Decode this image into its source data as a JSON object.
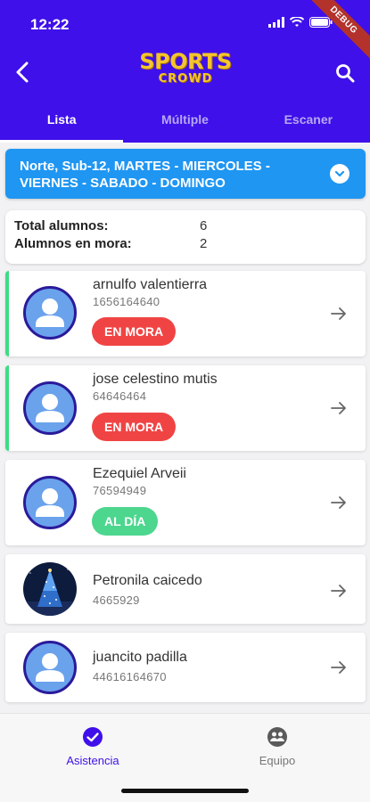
{
  "status": {
    "time": "12:22",
    "debug_label": "DEBUG"
  },
  "header": {
    "logo_line1": "SPORTS",
    "logo_line2": "CROWD"
  },
  "tabs": [
    {
      "label": "Lista",
      "active": true
    },
    {
      "label": "Múltiple",
      "active": false
    },
    {
      "label": "Escaner",
      "active": false
    }
  ],
  "schedule": {
    "text": "Norte, Sub-12, MARTES - MIERCOLES - VIERNES - SABADO - DOMINGO"
  },
  "totals": {
    "total_label": "Total alumnos:",
    "total_value": "6",
    "mora_label": "Alumnos en mora:",
    "mora_value": "2"
  },
  "students": [
    {
      "name": "arnulfo valentierra",
      "phone": "1656164640",
      "status": "EN MORA"
    },
    {
      "name": "jose celestino mutis",
      "phone": "64646464",
      "status": "EN MORA"
    },
    {
      "name": "Ezequiel Arveii",
      "phone": "76594949",
      "status": "AL DÍA"
    },
    {
      "name": "Petronila caicedo",
      "phone": "4665929",
      "status": ""
    },
    {
      "name": "juancito padilla",
      "phone": "44616164670",
      "status": ""
    }
  ],
  "bottom_nav": [
    {
      "label": "Asistencia",
      "active": true
    },
    {
      "label": "Equipo",
      "active": false
    }
  ],
  "colors": {
    "primary": "#3f10ea",
    "schedule_bg": "#1f96f2",
    "mora": "#f04444",
    "al_dia": "#4cd68e"
  }
}
